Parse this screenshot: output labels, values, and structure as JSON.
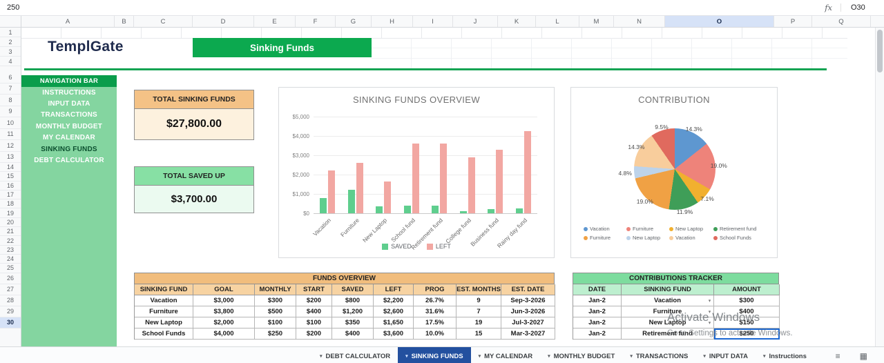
{
  "formula_bar": {
    "value": "250",
    "fx": "fx",
    "cell_ref": "O30"
  },
  "grid": {
    "columns": [
      "A",
      "B",
      "C",
      "D",
      "E",
      "F",
      "G",
      "H",
      "I",
      "J",
      "K",
      "L",
      "M",
      "N",
      "O",
      "P",
      "Q"
    ],
    "selected_column": "O",
    "rows": [
      "1",
      "2",
      "3",
      "4",
      "6",
      "7",
      "8",
      "9",
      "10",
      "11",
      "12",
      "13",
      "14",
      "15",
      "16",
      "17",
      "18",
      "19",
      "20",
      "21",
      "22",
      "23",
      "24",
      "25",
      "26",
      "27",
      "28",
      "29",
      "30"
    ],
    "selected_row": "30"
  },
  "header": {
    "logo": "TemplGate",
    "banner": "Sinking Funds"
  },
  "nav": {
    "title": "NAVIGATION BAR",
    "items": [
      {
        "label": "INSTRUCTIONS",
        "selected": false
      },
      {
        "label": "INPUT DATA",
        "selected": false
      },
      {
        "label": "TRANSACTIONS",
        "selected": false
      },
      {
        "label": "MONTHLY BUDGET",
        "selected": false
      },
      {
        "label": "MY CALENDAR",
        "selected": false
      },
      {
        "label": "SINKING FUNDS",
        "selected": true
      },
      {
        "label": "DEBT CALCULATOR",
        "selected": false
      }
    ]
  },
  "totals": [
    {
      "title": "TOTAL SINKING FUNDS",
      "value": "$27,800.00"
    },
    {
      "title": "TOTAL SAVED UP",
      "value": "$3,700.00"
    }
  ],
  "chart_data": [
    {
      "type": "bar",
      "title": "SINKING FUNDS OVERVIEW",
      "categories": [
        "Vacation",
        "Furniture",
        "New Laptop",
        "School fund",
        "Retirement fund",
        "College fund",
        "Business fund",
        "Rainy day fund"
      ],
      "series": [
        {
          "name": "SAVED",
          "color": "#5fce8e",
          "values": [
            800,
            1200,
            350,
            400,
            400,
            100,
            200,
            250
          ]
        },
        {
          "name": "LEFT",
          "color": "#f2a7a2",
          "values": [
            2200,
            2600,
            1650,
            3600,
            3600,
            2900,
            3300,
            4250
          ]
        }
      ],
      "ylim": [
        0,
        5000
      ],
      "yticks": [
        "$0",
        "$1,000",
        "$2,000",
        "$3,000",
        "$4,000",
        "$5,000"
      ],
      "grid": true,
      "legend_position": "bottom"
    },
    {
      "type": "pie",
      "title": "CONTRIBUTION",
      "slices": [
        {
          "label": "Vacation",
          "value": 14.3,
          "display": "14.3%",
          "color": "#5e97d0"
        },
        {
          "label": "Furniture",
          "value": 19.0,
          "display": "19.0%",
          "color": "#ee837a"
        },
        {
          "label": "New Laptop",
          "value": 7.1,
          "display": "7.1%",
          "color": "#f1b02f"
        },
        {
          "label": "Retirement fund",
          "value": 11.9,
          "display": "11.9%",
          "color": "#3f9e58"
        },
        {
          "label": "Furniture",
          "value": 19.0,
          "display": "19.0%",
          "color": "#f0a144"
        },
        {
          "label": "New Laptop",
          "value": 4.8,
          "display": "4.8%",
          "color": "#bdd3ea"
        },
        {
          "label": "Vacation",
          "value": 14.3,
          "display": "14.3%",
          "color": "#f8cd9c"
        },
        {
          "label": "School Funds",
          "value": 9.5,
          "display": "9.5%",
          "color": "#e06a5e"
        }
      ],
      "legend_position": "bottom"
    }
  ],
  "funds_table": {
    "title": "FUNDS OVERVIEW",
    "columns": [
      "SINKING FUND",
      "GOAL",
      "MONTHLY",
      "START",
      "SAVED",
      "LEFT",
      "PROG",
      "EST. MONTHS",
      "EST. DATE"
    ],
    "rows": [
      [
        "Vacation",
        "$3,000",
        "$300",
        "$200",
        "$800",
        "$2,200",
        "26.7%",
        "9",
        "Sep-3-2026"
      ],
      [
        "Furniture",
        "$3,800",
        "$500",
        "$400",
        "$1,200",
        "$2,600",
        "31.6%",
        "7",
        "Jun-3-2026"
      ],
      [
        "New Laptop",
        "$2,000",
        "$100",
        "$100",
        "$350",
        "$1,650",
        "17.5%",
        "19",
        "Jul-3-2027"
      ],
      [
        "School Funds",
        "$4,000",
        "$250",
        "$200",
        "$400",
        "$3,600",
        "10.0%",
        "15",
        "Mar-3-2027"
      ]
    ]
  },
  "contrib_table": {
    "title": "CONTRIBUTIONS TRACKER",
    "columns": [
      "DATE",
      "SINKING FUND",
      "AMOUNT"
    ],
    "rows": [
      {
        "date": "Jan-2",
        "fund": "Vacation",
        "amount": "$300",
        "dropdown": true,
        "selected": false
      },
      {
        "date": "Jan-2",
        "fund": "Furniture",
        "amount": "$400",
        "dropdown": true,
        "selected": false
      },
      {
        "date": "Jan-2",
        "fund": "New Laptop",
        "amount": "$150",
        "dropdown": true,
        "selected": false
      },
      {
        "date": "Jan-2",
        "fund": "Retirement fund",
        "amount": "$250",
        "dropdown": false,
        "selected": true
      }
    ]
  },
  "tabs": [
    {
      "label": "DEBT CALCULATOR",
      "active": false
    },
    {
      "label": "SINKING FUNDS",
      "active": true
    },
    {
      "label": "MY CALENDAR",
      "active": false
    },
    {
      "label": "MONTHLY BUDGET",
      "active": false
    },
    {
      "label": "TRANSACTIONS",
      "active": false
    },
    {
      "label": "INPUT DATA",
      "active": false
    },
    {
      "label": "Instructions",
      "active": false
    }
  ],
  "tabbar_icons": [
    {
      "name": "menu-icon",
      "glyph": "≡"
    },
    {
      "name": "grid-icon",
      "glyph": "▦"
    }
  ],
  "watermark": {
    "line1": "Activate Windows",
    "line2": "Go to Settings to activate Windows."
  }
}
